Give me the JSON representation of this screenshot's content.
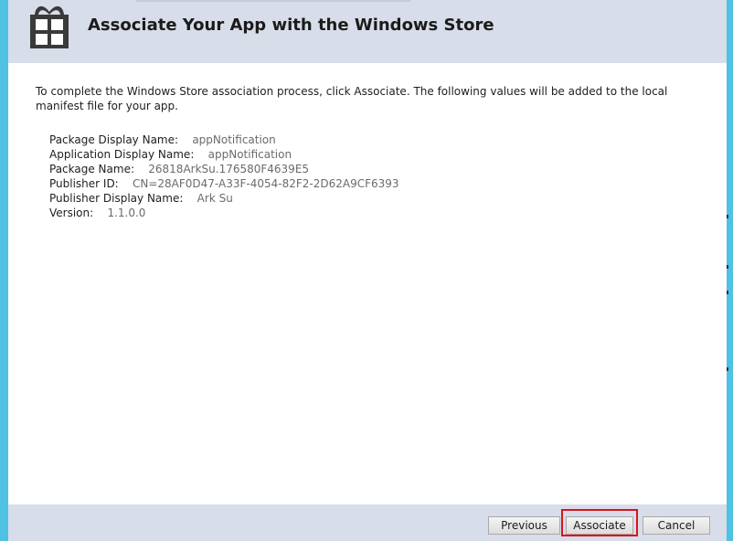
{
  "window": {
    "title": "Associate Your App with the Windows Store",
    "icon": "windows-store-icon"
  },
  "content": {
    "intro": "To complete the Windows Store association process, click Associate. The following values will be added to the local manifest file for your app.",
    "details": [
      {
        "label": "Package Display Name:",
        "value": "appNotification"
      },
      {
        "label": "Application Display Name:",
        "value": "appNotification"
      },
      {
        "label": "Package Name:",
        "value": "26818ArkSu.176580F4639E5"
      },
      {
        "label": "Publisher ID:",
        "value": "CN=28AF0D47-A33F-4054-82F2-2D62A9CF6393"
      },
      {
        "label": "Publisher Display Name:",
        "value": "Ark Su"
      },
      {
        "label": "Version:",
        "value": "1.1.0.0"
      }
    ]
  },
  "footer": {
    "previous_label": "Previous",
    "associate_label": "Associate",
    "cancel_label": "Cancel"
  },
  "colors": {
    "accent_border": "#4fc1e3",
    "header_background": "#d7dde9",
    "highlight": "#d9141a"
  }
}
